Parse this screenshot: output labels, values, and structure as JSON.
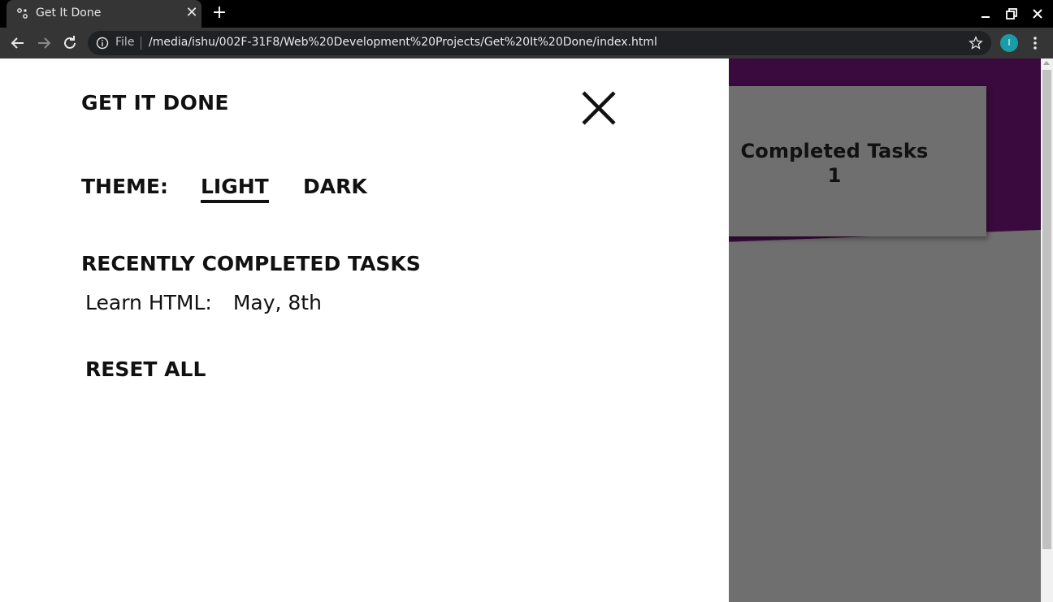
{
  "browser": {
    "tab_title": "Get It Done",
    "url_scheme": "File",
    "url": "/media/ishu/002F-31F8/Web%20Development%20Projects/Get%20It%20Done/index.html",
    "profile_initial": "I",
    "profile_color": "#1a9ba8"
  },
  "panel": {
    "title": "GET IT DONE",
    "theme_label": "THEME:",
    "theme_options": [
      "LIGHT",
      "DARK"
    ],
    "selected_theme": "LIGHT",
    "recent_heading": "RECENTLY COMPLETED TASKS",
    "recent_tasks": [
      {
        "task": "Learn HTML:",
        "date": "May, 8th"
      }
    ],
    "reset_label": "RESET ALL"
  },
  "background": {
    "counter_title": "Completed Tasks",
    "counter_value": "1",
    "accent_color": "#3a0a3e",
    "page_color": "#6f6f6f"
  }
}
